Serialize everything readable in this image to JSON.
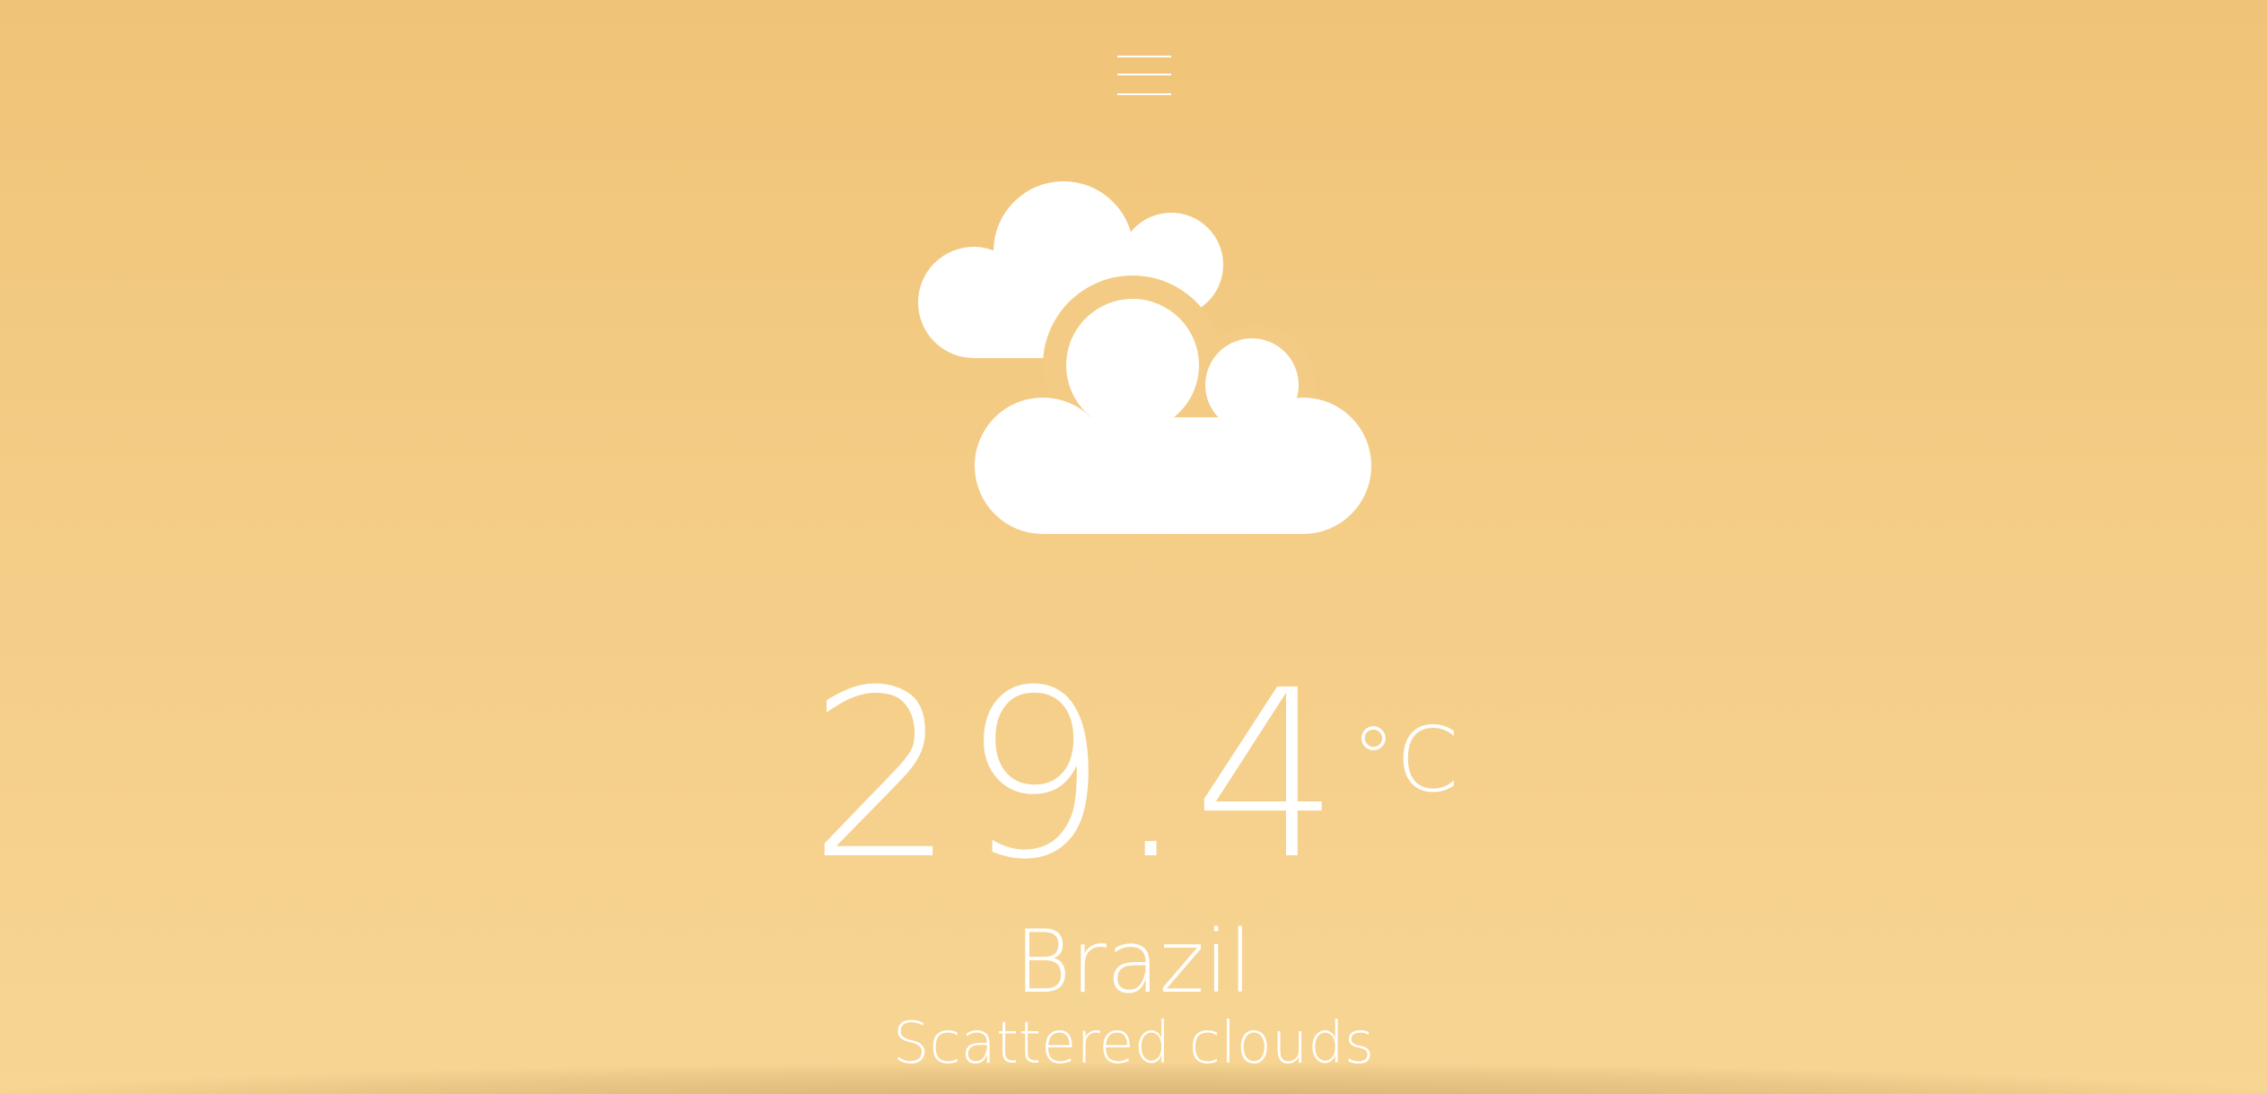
{
  "app": {
    "accent_color": "#f2c980",
    "text_color": "#ffffff"
  },
  "menu": {
    "icon": "hamburger-menu-icon"
  },
  "weather": {
    "icon": "scattered-clouds-icon",
    "temperature": "29.4",
    "unit": "°C",
    "location": "Brazil",
    "condition": "Scattered clouds"
  }
}
